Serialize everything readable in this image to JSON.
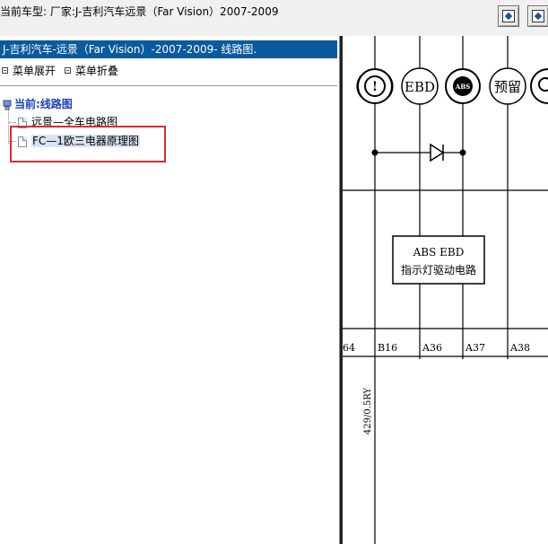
{
  "header": {
    "car_model_label": "当前车型:   厂家:J-吉利汽车远景（Far Vision）2007-2009"
  },
  "toolbar": {
    "buttons": [
      {
        "name": "toolbar-button-1",
        "icon": "window-diamond-icon"
      },
      {
        "name": "toolbar-button-2",
        "icon": "window-diamond-icon"
      }
    ]
  },
  "left_panel": {
    "path_title": "J-吉利汽车-远景（Far Vision）-2007-2009- 线路图.",
    "menu_expand": "菜单展开",
    "menu_collapse": "菜单折叠",
    "tree": {
      "root_label": "当前:线路图",
      "items": [
        {
          "label": "远景—全车电路图",
          "selected": false
        },
        {
          "label": "FC—1欧三电器原理图",
          "selected": true
        }
      ]
    }
  },
  "diagram": {
    "symbols": [
      "brake-warning-symbol",
      "EBD",
      "ABS",
      "预留"
    ],
    "box_line1": "ABS EBD",
    "box_line2": "指示灯驱动电路",
    "pins": [
      "64",
      "B16",
      "A36",
      "A37",
      "A38"
    ],
    "wire_label": "429/0.5RY",
    "colors": {
      "highlight": "#e0282e",
      "path_bar": "#0a5a9e",
      "tree_root": "#1b3fbf"
    }
  }
}
